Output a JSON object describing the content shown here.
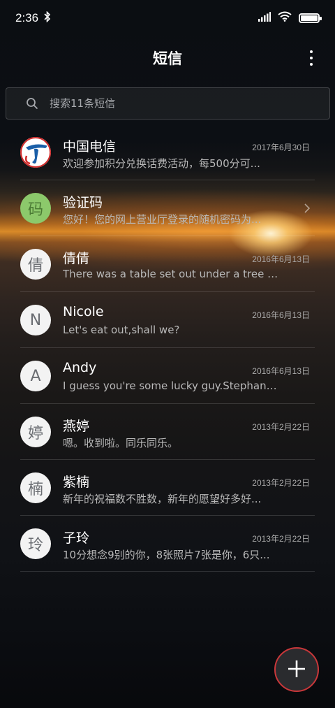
{
  "status_bar": {
    "time": "2:36",
    "bluetooth_icon": "bluetooth-icon",
    "signal_icon": "cell-signal-icon",
    "wifi_icon": "wifi-icon",
    "battery_icon": "battery-icon",
    "battery_level": 1.0
  },
  "header": {
    "title": "短信",
    "more_icon": "more-vertical-icon"
  },
  "search": {
    "icon": "search-icon",
    "placeholder": "搜索11条短信"
  },
  "conversations": [
    {
      "name": "中国电信",
      "date": "2017年6月30日",
      "preview": "欢迎参加积分兑换话费活动，每500分可...",
      "avatar": "",
      "avatar_type": "china-telecom-logo",
      "avatar_bg": "#ffffff"
    },
    {
      "name": "验证码",
      "date": "",
      "preview": "您好！您的网上营业厅登录的随机密码为...",
      "avatar": "码",
      "avatar_type": "text",
      "avatar_bg": "#8cc96b",
      "avatar_color": "#4a7a34"
    },
    {
      "name": "倩倩",
      "date": "2016年6月13日",
      "preview": "There was a table set out under a tree i...",
      "avatar": "倩",
      "avatar_type": "text",
      "avatar_bg": "#f3f3f3",
      "avatar_color": "#6a6d72"
    },
    {
      "name": "Nicole",
      "date": "2016年6月13日",
      "preview": "Let's eat out,shall we?",
      "avatar": "N",
      "avatar_type": "text",
      "avatar_bg": "#f3f3f3",
      "avatar_color": "#6a6d72"
    },
    {
      "name": "Andy",
      "date": "2016年6月13日",
      "preview": "I guess you're some lucky guy.Stephani...",
      "avatar": "A",
      "avatar_type": "text",
      "avatar_bg": "#f3f3f3",
      "avatar_color": "#6a6d72"
    },
    {
      "name": "燕婷",
      "date": "2013年2月22日",
      "preview": "嗯。收到啦。同乐同乐。",
      "avatar": "婷",
      "avatar_type": "text",
      "avatar_bg": "#f3f3f3",
      "avatar_color": "#6a6d72"
    },
    {
      "name": "紫楠",
      "date": "2013年2月22日",
      "preview": "新年的祝福数不胜数，新年的愿望好多好...",
      "avatar": "楠",
      "avatar_type": "text",
      "avatar_bg": "#f3f3f3",
      "avatar_color": "#6a6d72"
    },
    {
      "name": "子玲",
      "date": "2013年2月22日",
      "preview": "10分想念9别的你，8张照片7张是你，6只...",
      "avatar": "玲",
      "avatar_type": "text",
      "avatar_bg": "#f3f3f3",
      "avatar_color": "#6a6d72"
    }
  ],
  "fab": {
    "icon": "plus-icon",
    "border_color": "#c9373a"
  }
}
